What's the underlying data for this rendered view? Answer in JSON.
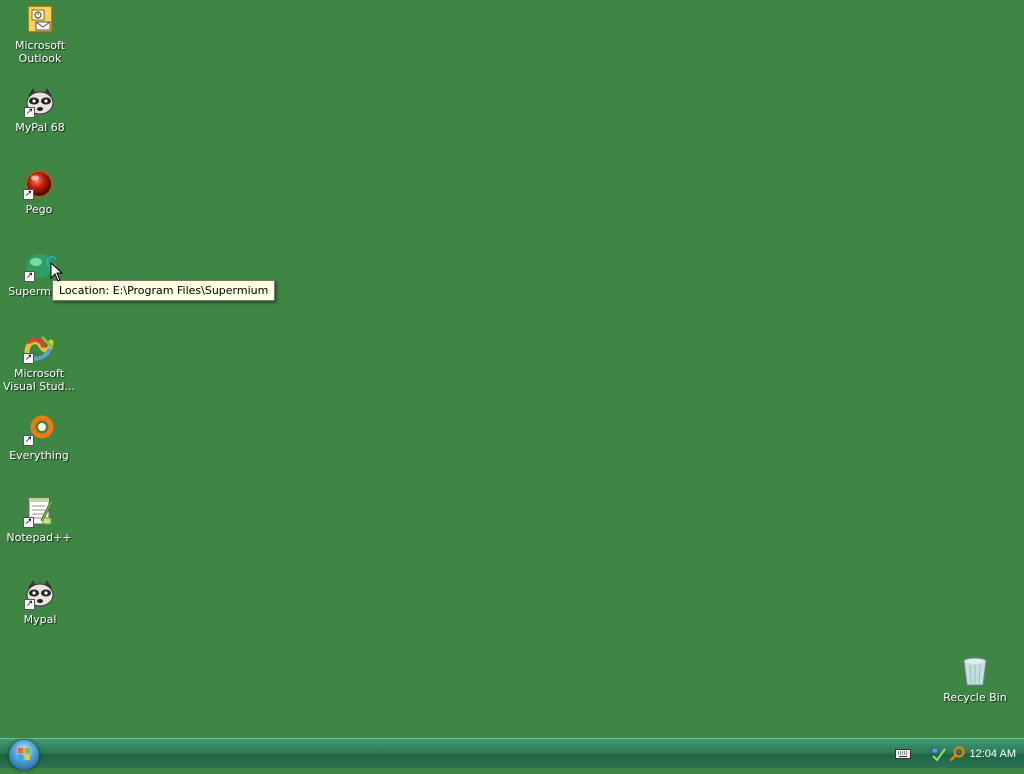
{
  "desktop": {
    "background_color": "#3f8645",
    "icons": [
      {
        "label": "Microsoft Outlook",
        "icon": "outlook-icon"
      },
      {
        "label": "MyPal 68",
        "icon": "raccoon-icon"
      },
      {
        "label": "Pego",
        "icon": "red-sphere-icon"
      },
      {
        "label": "Supermium",
        "icon": "supermium-icon"
      },
      {
        "label": "Microsoft Visual Stud...",
        "icon": "visual-studio-icon"
      },
      {
        "label": "Everything",
        "icon": "magnifier-ring-icon"
      },
      {
        "label": "Notepad++",
        "icon": "notepad-icon"
      },
      {
        "label": "Mypal",
        "icon": "raccoon-icon"
      }
    ],
    "recycle_bin": {
      "label": "Recycle Bin",
      "icon": "recycle-bin-icon"
    }
  },
  "tooltip": {
    "text": "Location: E:\\Program Files\\Supermium"
  },
  "taskbar": {
    "start_button": "windows-orb-icon",
    "tray_icons": [
      "keyboard-icon",
      "network-icon",
      "search-icon"
    ],
    "clock": "12:04 AM"
  }
}
